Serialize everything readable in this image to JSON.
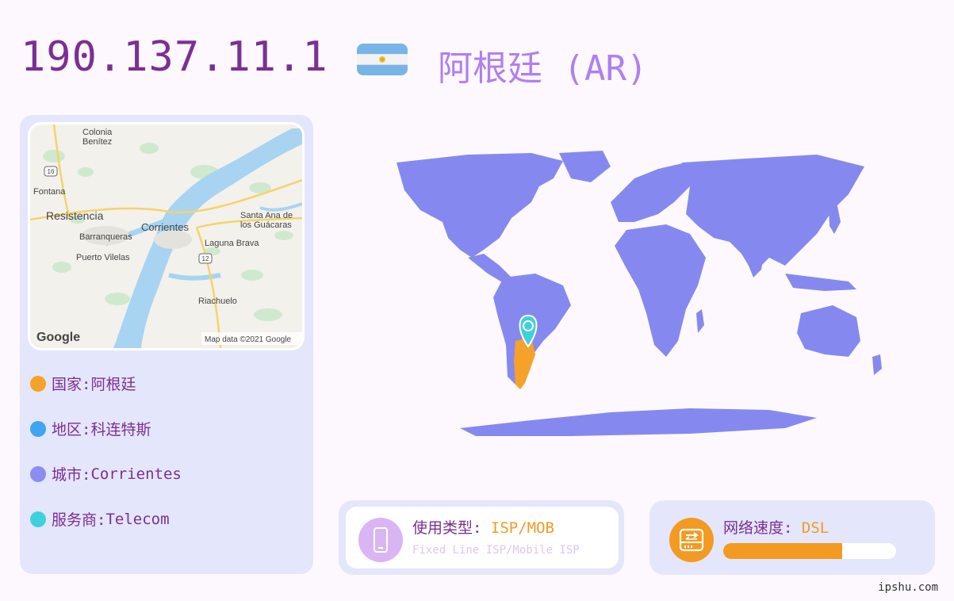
{
  "header": {
    "ip": "190.137.11.1",
    "country_title": "阿根廷 (AR)"
  },
  "map": {
    "places": {
      "colonia_benitez": [
        "Colonia",
        "Benítez"
      ],
      "fontana": "Fontana",
      "resistencia": "Resistencia",
      "barranqueras": "Barranqueras",
      "corrientes": "Corrientes",
      "puerto_vilelas": "Puerto Vilelas",
      "laguna_brava": "Laguna Brava",
      "santa_ana": [
        "Santa Ana de",
        "los Guácaras"
      ],
      "riachuelo": "Riachuelo"
    },
    "route_shields": [
      "16",
      "12"
    ],
    "logo": "Google",
    "attribution": "Map data ©2021 Google"
  },
  "info": [
    {
      "label": "国家: ",
      "value": "阿根廷",
      "color": "#f6a12a"
    },
    {
      "label": "地区: ",
      "value": "科连特斯",
      "color": "#3fa4f2"
    },
    {
      "label": "城市: ",
      "value": "Corrientes",
      "color": "#8a8ef0"
    },
    {
      "label": "服务商: ",
      "value": "Telecom",
      "color": "#3fd0de"
    }
  ],
  "usage": {
    "label": "使用类型: ",
    "value": "ISP/MOB",
    "subtitle": "Fixed Line ISP/Mobile ISP",
    "icon": "mobile-phone-icon"
  },
  "speed": {
    "label": "网络速度: ",
    "value": "DSL",
    "level": 0.69,
    "icon": "network-device-icon"
  },
  "footer": "ipshu.com",
  "colors": {
    "ip_text": "#7b2f93",
    "country_text": "#b07ff0",
    "world_land": "#8589ef",
    "highlight_country": "#f6a12a",
    "pin": "#3fd0de",
    "accent": "#f39a22"
  }
}
